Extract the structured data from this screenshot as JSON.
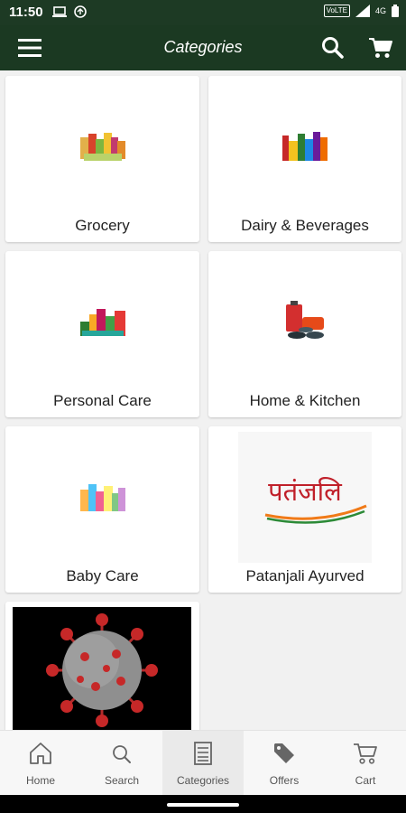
{
  "status_bar": {
    "time": "11:50",
    "network": "VoLTE",
    "signal_text": "4G",
    "left_icons": [
      "laptop-icon",
      "sync-icon"
    ],
    "right_icons": [
      "signal-icon",
      "battery-icon"
    ]
  },
  "app_bar": {
    "title": "Categories",
    "menu_icon": "hamburger-icon",
    "search_icon": "search-icon",
    "cart_icon": "cart-icon"
  },
  "categories": [
    {
      "label": "Grocery"
    },
    {
      "label": "Dairy & Beverages"
    },
    {
      "label": "Personal Care"
    },
    {
      "label": "Home & Kitchen"
    },
    {
      "label": "Baby Care"
    },
    {
      "label": "Patanjali Ayurved",
      "logo_text": "पतंजलि"
    },
    {
      "label": ""
    }
  ],
  "bottom_nav": [
    {
      "label": "Home",
      "icon": "home-icon"
    },
    {
      "label": "Search",
      "icon": "search-icon"
    },
    {
      "label": "Categories",
      "icon": "categories-icon",
      "active": true
    },
    {
      "label": "Offers",
      "icon": "tag-icon"
    },
    {
      "label": "Cart",
      "icon": "cart-icon"
    }
  ],
  "colors": {
    "app_bar": "#1b3922",
    "status_bar": "#1d3a24",
    "background": "#f1f1f1",
    "brand_red": "#c0202a",
    "brand_orange": "#f07a18",
    "brand_green": "#2c8a37"
  }
}
